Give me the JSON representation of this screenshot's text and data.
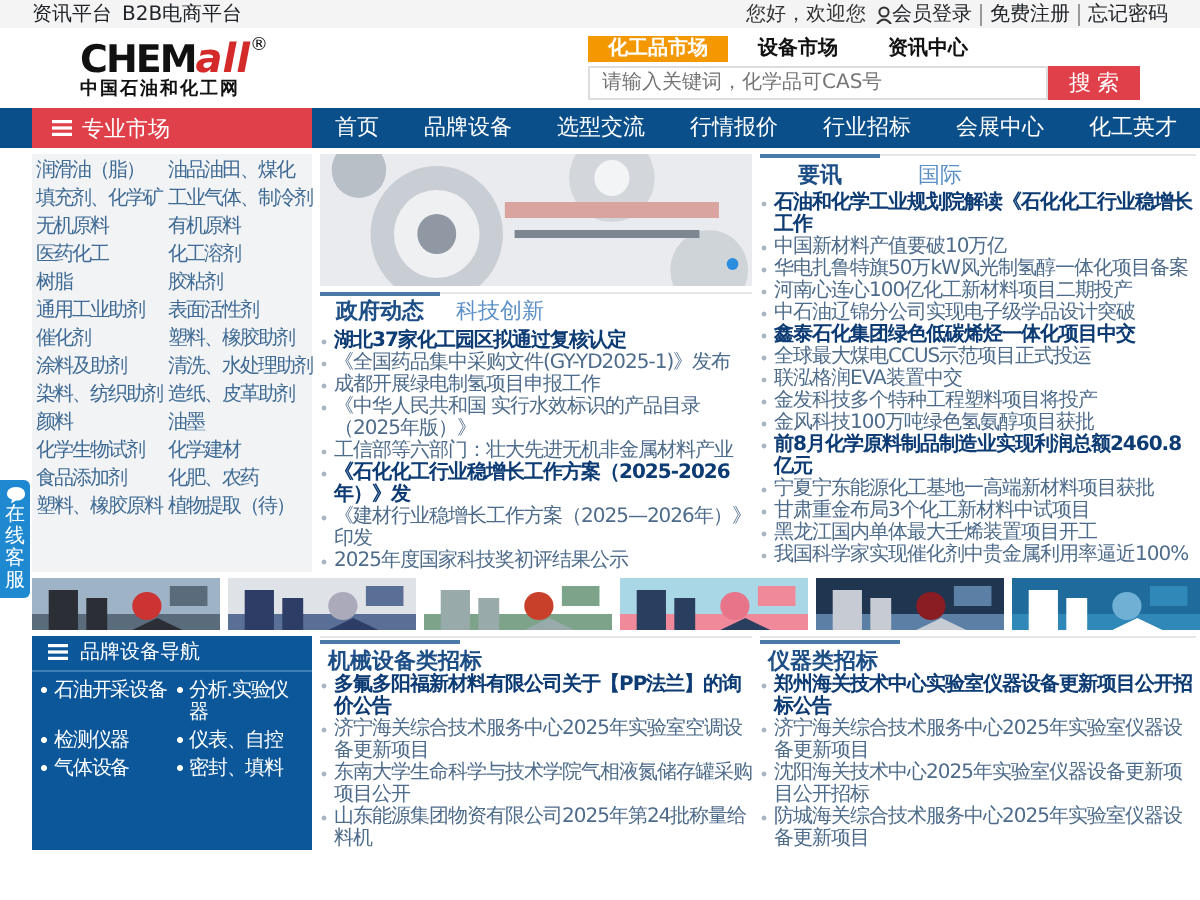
{
  "top_bar": {
    "left_links": [
      "资讯平台",
      "B2B电商平台"
    ],
    "greeting": "您好，欢迎您",
    "login": "会员登录",
    "links": [
      "免费注册",
      "忘记密码"
    ]
  },
  "logo": {
    "main": "CHEM",
    "accent": "all",
    "mark": "®",
    "tagline": "中国石油和化工网"
  },
  "search": {
    "tabs": [
      {
        "label": "化工品市场",
        "selected": true
      },
      {
        "label": "设备市场",
        "selected": false
      },
      {
        "label": "资讯中心",
        "selected": false
      }
    ],
    "placeholder": "请输入关键词，化学品可CAS号",
    "button": "搜 索"
  },
  "nav": {
    "market": "专业市场",
    "items": [
      "首页",
      "品牌设备",
      "选型交流",
      "行情报价",
      "行业招标",
      "会展中心",
      "化工英才"
    ]
  },
  "categories": [
    "润滑油（脂）",
    "油品油田、煤化",
    "填充剂、化学矿",
    "工业气体、制冷剂",
    "无机原料",
    "有机原料",
    "医药化工",
    "化工溶剂",
    "树脂",
    "胶粘剂",
    "通用工业助剂",
    "表面活性剂",
    "催化剂",
    "塑料、橡胶助剂",
    "涂料及助剂",
    "清洗、水处理助剂",
    "染料、纺织助剂",
    "造纸、皮革助剂",
    "颜料",
    "油墨",
    "化学生物试剂",
    "化学建材",
    "食品添加剂",
    "化肥、农药",
    "塑料、橡胶原料",
    "植物提取（待）"
  ],
  "gov_news": {
    "tabs": [
      {
        "label": "政府动态",
        "selected": true
      },
      {
        "label": "科技创新",
        "selected": false
      }
    ],
    "items": [
      {
        "text": "湖北37家化工园区拟通过复核认定",
        "kind": "headline"
      },
      {
        "text": "《全国药品集中采购文件(GY-YD2025-1)》发布",
        "kind": "link"
      },
      {
        "text": "成都开展绿电制氢项目申报工作",
        "kind": "link"
      },
      {
        "text": "《中华人民共和国 实行水效标识的产品目录（2025年版）》",
        "kind": "link"
      },
      {
        "text": "工信部等六部门：壮大先进无机非金属材料产业",
        "kind": "link"
      },
      {
        "text": "《石化化工行业稳增长工作方案（2025-2026年）》发",
        "kind": "headline"
      },
      {
        "text": "《建材行业稳增长工作方案（2025—2026年）》印发",
        "kind": "link"
      },
      {
        "text": "2025年度国家科技奖初评结果公示",
        "kind": "link"
      }
    ]
  },
  "top_news": {
    "tabs": [
      {
        "label": "要讯",
        "selected": true
      },
      {
        "label": "国际",
        "selected": false
      }
    ],
    "items": [
      {
        "text": "石油和化学工业规划院解读《石化化工行业稳增长工作",
        "kind": "headline"
      },
      {
        "text": "中国新材料产值要破10万亿",
        "kind": "link"
      },
      {
        "text": "华电扎鲁特旗50万kW风光制氢醇一体化项目备案",
        "kind": "link"
      },
      {
        "text": "河南心连心100亿化工新材料项目二期投产",
        "kind": "link"
      },
      {
        "text": "中石油辽锦分公司实现电子级学品设计突破",
        "kind": "link"
      },
      {
        "text": "鑫泰石化集团绿色低碳烯烃一体化项目中交",
        "kind": "headline"
      },
      {
        "text": "全球最大煤电CCUS示范项目正式投运",
        "kind": "link"
      },
      {
        "text": "联泓格润EVA装置中交",
        "kind": "link"
      },
      {
        "text": "金发科技多个特种工程塑料项目将投产",
        "kind": "link"
      },
      {
        "text": "金风科技100万吨绿色氢氨醇项目获批",
        "kind": "link"
      },
      {
        "text": "前8月化学原料制品制造业实现利润总额2460.8亿元",
        "kind": "headline"
      },
      {
        "text": "宁夏宁东能源化工基地一高端新材料项目获批",
        "kind": "link"
      },
      {
        "text": "甘肃重金布局3个化工新材料中试项目",
        "kind": "link"
      },
      {
        "text": "黑龙江国内单体最大壬烯装置项目开工",
        "kind": "link"
      },
      {
        "text": "我国科学家实现催化剂中贵金属利用率逼近100%",
        "kind": "link"
      }
    ]
  },
  "equipment_nav": {
    "title": "品牌设备导航",
    "items": [
      "石油开采设备",
      "分析.实验仪器",
      "检测仪器",
      "仪表、自控",
      "气体设备",
      "密封、填料"
    ]
  },
  "machinery_bids": {
    "title": "机械设备类招标",
    "items": [
      {
        "text": "多氟多阳福新材料有限公司关于【PP法兰】的询价公告",
        "kind": "headline"
      },
      {
        "text": "济宁海关综合技术服务中心2025年实验室空调设备更新项目",
        "kind": "link"
      },
      {
        "text": "东南大学生命科学与技术学院气相液氮储存罐采购项目公开",
        "kind": "link"
      },
      {
        "text": "山东能源集团物资有限公司2025年第24批称量给料机",
        "kind": "link"
      }
    ]
  },
  "instrument_bids": {
    "title": "仪器类招标",
    "items": [
      {
        "text": "郑州海关技术中心实验室仪器设备更新项目公开招标公告",
        "kind": "headline"
      },
      {
        "text": "济宁海关综合技术服务中心2025年实验室仪器设备更新项目",
        "kind": "link"
      },
      {
        "text": "沈阳海关技术中心2025年实验室仪器设备更新项目公开招标",
        "kind": "link"
      },
      {
        "text": "防城海关综合技术服务中心2025年实验室仪器设备更新项目",
        "kind": "link"
      }
    ]
  },
  "service_tab": {
    "label": "在线客服"
  }
}
